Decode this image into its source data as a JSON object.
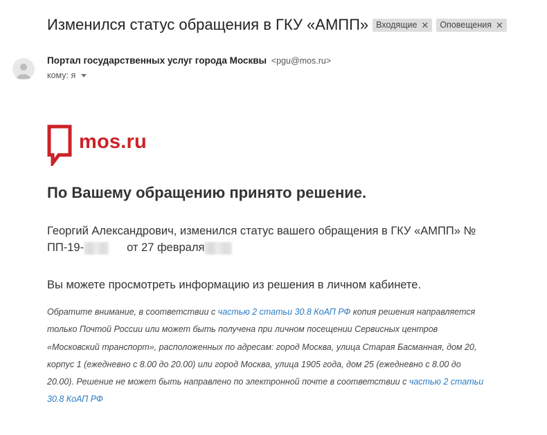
{
  "email": {
    "subject": "Изменился статус обращения в ГКУ «АМПП»",
    "labels": [
      "Входящие",
      "Оповещения"
    ],
    "sender_name": "Портал государственных услуг города Москвы",
    "sender_email": "<pgu@mos.ru>",
    "to": "кому: я"
  },
  "body": {
    "logo_text": "mos.ru",
    "headline": "По Вашему обращению принято решение.",
    "status_line_1": "Георгий Александрович, изменился статус вашего обращения в ГКУ «АМПП» №",
    "status_prefix": "ПП-19-",
    "status_date": "от 27 февраля",
    "cabinet_line": "Вы можете просмотреть информацию из решения в личном кабинете.",
    "note": {
      "part1": "Обратите внимание, в соответствии с ",
      "link1": "частью 2 статьи 30.8 КоАП РФ",
      "part2": " копия решения направляется только Почтой России или может быть получена при личном посещении Сервисных центров «Московский транспорт», расположенных по адресам: город Москва, улица Старая Басманная, дом 20, корпус 1 (ежедневно с 8.00 до 20.00) или город Москва, улица 1905 года, дом 25 (ежедневно с 8.00 до 20.00). Решение не может быть направлено по электронной почте в соответствии с ",
      "link2": "частью 2 статьи 30.8 КоАП РФ"
    }
  },
  "colors": {
    "brand": "#cc2229",
    "link": "#2a7ac4",
    "chip": "#dddddd"
  },
  "icons": {
    "avatar": "person-icon",
    "chip_close": "close-icon",
    "to_caret": "caret-down-icon",
    "logo": "speech-bubble-icon"
  }
}
